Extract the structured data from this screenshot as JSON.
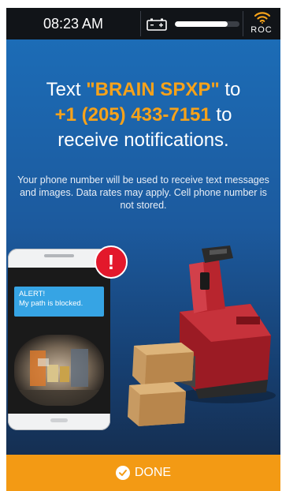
{
  "status_bar": {
    "time": "08:23 AM",
    "battery_icon": "battery-icon",
    "level_fraction": 0.82,
    "wifi_icon": "wifi-icon",
    "network_label": "ROC"
  },
  "main": {
    "headline": {
      "prefix": "Text ",
      "keyword": "\"BRAIN SPXP\"",
      "middle": " to",
      "phone_number": "+1 (205) 433-7151",
      "suffix": " to",
      "line3": "receive notifications."
    },
    "subtext": "Your phone number will be used to receive text messages and images. Data rates may apply. Cell phone number is not stored.",
    "phone_illustration": {
      "alert_title": "ALERT!",
      "alert_message": "My path is blocked.",
      "badge_symbol": "!"
    }
  },
  "footer": {
    "done_label": "DONE",
    "done_icon": "check-circle-icon"
  },
  "colors": {
    "accent": "#f6a21a",
    "done_bar": "#f39a14",
    "alert_blue": "#36a4e4",
    "badge_red": "#e3182b"
  }
}
